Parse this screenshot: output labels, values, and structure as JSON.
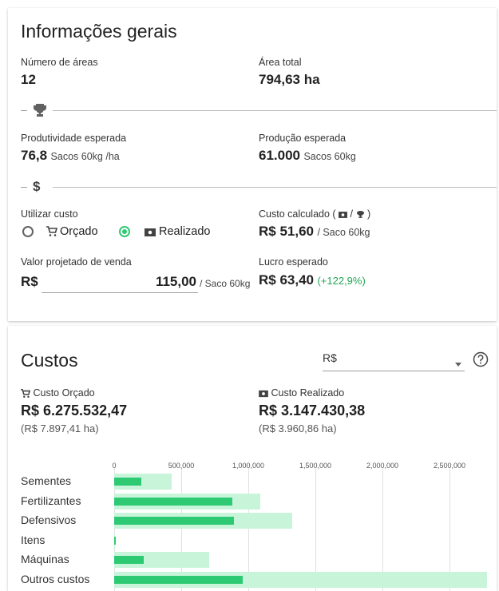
{
  "general": {
    "title": "Informações gerais",
    "areas_label": "Número de áreas",
    "areas_value": "12",
    "total_area_label": "Área total",
    "total_area_value": "794,63 ha",
    "productivity_label": "Produtividade esperada",
    "productivity_value": "76,8",
    "productivity_unit": "Sacos 60kg /ha",
    "production_label": "Produção esperada",
    "production_value": "61.000",
    "production_unit": "Sacos 60kg",
    "use_cost_label": "Utilizar custo",
    "option_budgeted": "Orçado",
    "option_realized": "Realizado",
    "selected_option": "Realizado",
    "calc_cost_label_prefix": "Custo calculado (",
    "calc_cost_label_mid": "/",
    "calc_cost_label_suffix": ")",
    "calc_cost_value": "R$ 51,60",
    "calc_cost_unit": "/ Saco 60kg",
    "sale_value_label": "Valor projetado de venda",
    "sale_currency": "R$",
    "sale_value": "115,00",
    "sale_unit": "/ Saco 60kg",
    "profit_label": "Lucro esperado",
    "profit_value": "R$ 63,40",
    "profit_percent": "(+122,9%)"
  },
  "costs": {
    "title": "Custos",
    "currency_select": "R$",
    "budgeted_label": "Custo Orçado",
    "budgeted_value": "R$ 6.275.532,47",
    "budgeted_per_ha": "(R$ 7.897,41 ha)",
    "realized_label": "Custo Realizado",
    "realized_value": "R$ 3.147.430,38",
    "realized_per_ha": "(R$ 3.960,86 ha)"
  },
  "colors": {
    "realized_bar": "#2ec973",
    "budgeted_bar": "#c8f5da",
    "accent_green": "#2ec973",
    "positive_text": "#22a857"
  },
  "chart_data": {
    "type": "bar",
    "orientation": "horizontal",
    "categories": [
      "Sementes",
      "Fertilizantes",
      "Defensivos",
      "Itens",
      "Máquinas",
      "Outros custos"
    ],
    "series": [
      {
        "values": [
          430000,
          1090000,
          1330000,
          5000,
          710000,
          2780000
        ]
      },
      {
        "values": [
          200000,
          880000,
          890000,
          10000,
          220000,
          960000
        ]
      }
    ],
    "xticks": [
      "0",
      "500,000",
      "1,000,000",
      "1,500,000",
      "2,000,000",
      "2,500,000"
    ],
    "xlim": [
      0,
      2800000
    ],
    "grid": true
  }
}
